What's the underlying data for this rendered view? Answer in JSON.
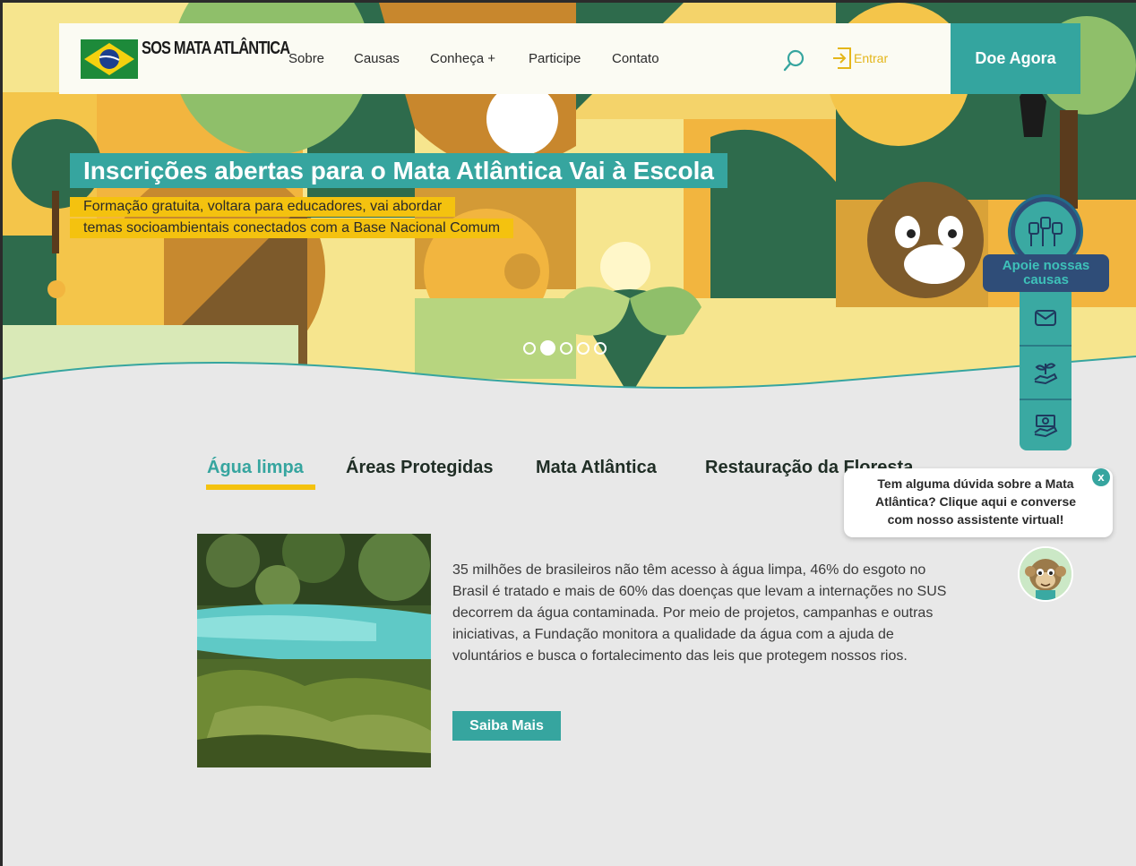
{
  "header": {
    "logo_text": "SOS MATA ATLÂNTICA",
    "nav": [
      {
        "label": "Sobre"
      },
      {
        "label": "Causas"
      },
      {
        "label": "Conheça +"
      },
      {
        "label": "Participe"
      },
      {
        "label": "Contato"
      }
    ],
    "search_icon": "search-icon",
    "login_label": "Entrar",
    "donate_label": "Doe Agora"
  },
  "hero": {
    "title": "Inscrições abertas para o Mata Atlântica Vai à Escola",
    "subtitle_line1": "Formação gratuita, voltara para educadores, vai abordar",
    "subtitle_line2": "temas socioambientais conectados com a Base Nacional Comum",
    "slides_total": 5,
    "active_slide": 2
  },
  "side_panel": {
    "apoie_label": "Apoie nossas causas",
    "buttons": [
      {
        "icon": "mail-icon"
      },
      {
        "icon": "plant-hand-icon"
      },
      {
        "icon": "money-hand-icon"
      }
    ]
  },
  "tabs": [
    {
      "label": "Água limpa",
      "active": true
    },
    {
      "label": "Áreas Protegidas",
      "active": false
    },
    {
      "label": "Mata Atlântica",
      "active": false
    },
    {
      "label": "Restauração da Floresta",
      "active": false
    }
  ],
  "content": {
    "description": "35 milhões de brasileiros não têm acesso à água limpa, 46% do esgoto no Brasil é tratado e mais de 60% das doenças que levam a internações no SUS decorrem da água contaminada. Por meio de projetos, campanhas e outras iniciativas, a Fundação monitora a qualidade da água com a ajuda de voluntários e busca o fortalecimento das leis que protegem nossos rios.",
    "button_label": "Saiba Mais"
  },
  "chat": {
    "message": "Tem alguma dúvida sobre a Mata Atlântica? Clique aqui e converse com nosso assistente virtual!",
    "close_label": "x"
  },
  "colors": {
    "accent": "#36a59f",
    "yellow": "#f4c20f",
    "navy": "#2f4d78"
  }
}
